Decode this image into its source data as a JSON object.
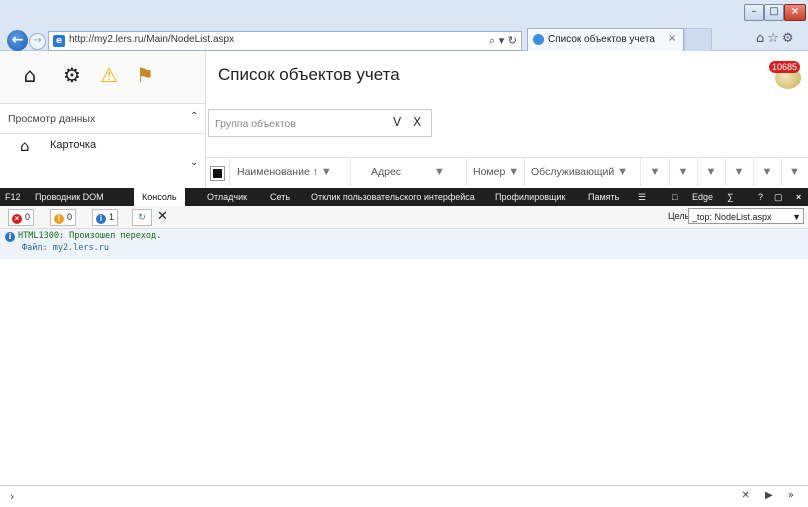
{
  "browser": {
    "url": "http://my2.lers.ru/Main/NodeList.aspx",
    "address_tools": "⌕ ▾ ↻",
    "tab_title": "Список объектов учета",
    "tab_close": "×",
    "window_buttons": [
      "–",
      "□",
      "×"
    ],
    "right_icons": "⌂☆⚙"
  },
  "app": {
    "title": "Список объектов учета",
    "notification_count": "10685",
    "panel_header": "Просмотр данных",
    "card_item": "Карточка",
    "group_filter": {
      "placeholder": "Группа объектов",
      "dropdown": "V",
      "clear": "X"
    },
    "grid": {
      "columns": [
        "Наименование",
        "Адрес",
        "Номер",
        "Обслуживающий"
      ],
      "sort_indicator": "↑",
      "filter_icon": "▼"
    }
  },
  "devtools": {
    "tabs": [
      "F12",
      "Проводник DOM",
      "Консоль",
      "Отладчик",
      "Сеть",
      "Отклик пользовательского интерфейса",
      "Профилировщик",
      "Память"
    ],
    "active_tab": "Консоль",
    "right_tools": [
      "Edge"
    ],
    "errors": "0",
    "warnings": "0",
    "info": "1",
    "clear": "✕",
    "target_label": "Цель:",
    "target_value": "_top: NodeList.aspx",
    "message_line1": "HTML1300: Произошел переход.",
    "message_line2": "Файл: my2.lers.ru",
    "prompt": "›",
    "input_actions": "✕ ▶ »"
  },
  "colors": {
    "error": "#d42020",
    "warning": "#e8a020",
    "info": "#2a74c8"
  }
}
